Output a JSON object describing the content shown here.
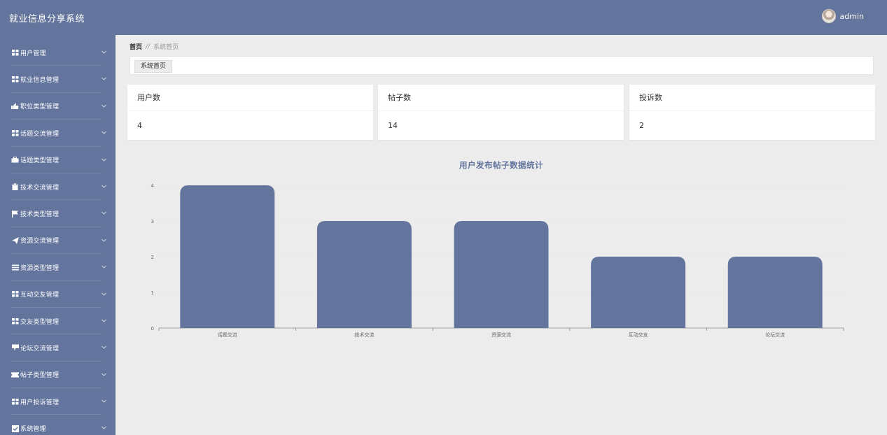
{
  "app": {
    "title": "就业信息分享系统"
  },
  "user": {
    "name": "admin"
  },
  "sidebar": {
    "items": [
      {
        "label": "用户管理",
        "icon": "grid-icon"
      },
      {
        "label": "就业信息管理",
        "icon": "grid-icon"
      },
      {
        "label": "职位类型管理",
        "icon": "thumbs-up-icon"
      },
      {
        "label": "话题交流管理",
        "icon": "grid-icon"
      },
      {
        "label": "话题类型管理",
        "icon": "briefcase-icon"
      },
      {
        "label": "技术交流管理",
        "icon": "clipboard-icon"
      },
      {
        "label": "技术类型管理",
        "icon": "flag-icon"
      },
      {
        "label": "资源交流管理",
        "icon": "send-icon"
      },
      {
        "label": "资源类型管理",
        "icon": "list-icon"
      },
      {
        "label": "互动交友管理",
        "icon": "grid-icon"
      },
      {
        "label": "交友类型管理",
        "icon": "grid-icon"
      },
      {
        "label": "论坛交流管理",
        "icon": "comment-icon"
      },
      {
        "label": "帖子类型管理",
        "icon": "ticket-icon"
      },
      {
        "label": "用户投诉管理",
        "icon": "grid-icon"
      },
      {
        "label": "系统管理",
        "icon": "checkbox-icon"
      }
    ]
  },
  "breadcrumb": {
    "home": "首页",
    "separator": "//",
    "current": "系统首页"
  },
  "tabs": {
    "active": "系统首页"
  },
  "stats": [
    {
      "label": "用户数",
      "value": "4"
    },
    {
      "label": "帖子数",
      "value": "14"
    },
    {
      "label": "投诉数",
      "value": "2"
    }
  ],
  "chart_data": {
    "type": "bar",
    "title": "用户发布帖子数据统计",
    "categories": [
      "话题交流",
      "技术交流",
      "资源交流",
      "互动交友",
      "论坛交流"
    ],
    "values": [
      4,
      3,
      3,
      2,
      2
    ],
    "ylim": [
      0,
      4
    ],
    "yticks": [
      0,
      1,
      2,
      3,
      4
    ],
    "xlabel": "",
    "ylabel": "",
    "grid": true,
    "color": "#63759c"
  },
  "colors": {
    "primary": "#63759c",
    "background": "#ececec"
  }
}
